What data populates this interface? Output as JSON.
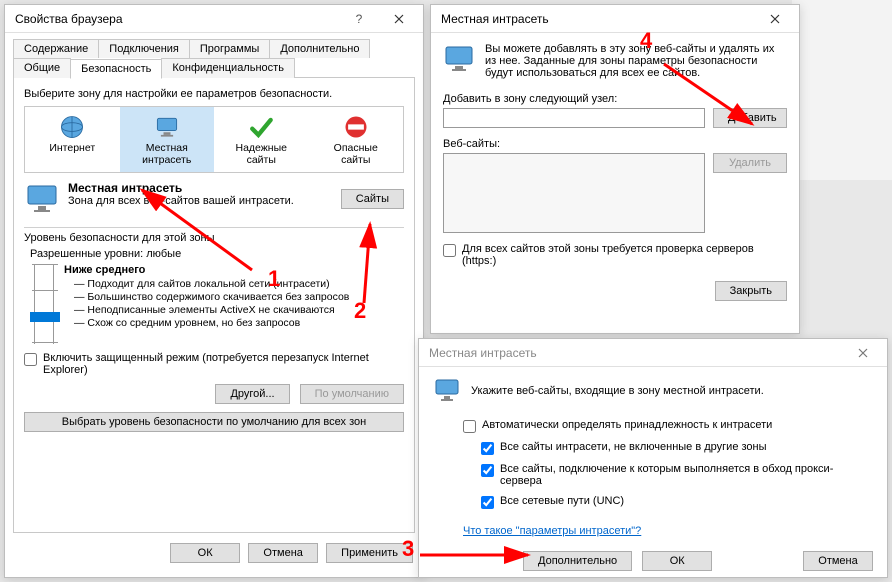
{
  "dlg1": {
    "title": "Свойства браузера",
    "tabs_row1": [
      "Содержание",
      "Подключения",
      "Программы",
      "Дополнительно"
    ],
    "tabs_row2": [
      "Общие",
      "Безопасность",
      "Конфиденциальность"
    ],
    "zone_prompt": "Выберите зону для настройки ее параметров безопасности.",
    "zones": [
      {
        "label": "Интернет"
      },
      {
        "label": "Местная\nинтрасеть"
      },
      {
        "label": "Надежные\nсайты"
      },
      {
        "label": "Опасные\nсайты"
      }
    ],
    "zone_header": "Местная интрасеть",
    "zone_desc": "Зона для всех веб-сайтов вашей интрасети.",
    "sites_btn": "Сайты",
    "level_group": "Уровень безопасности для этой зоны",
    "level_allowed": "Разрешенные уровни: любые",
    "level_name": "Ниже среднего",
    "level_points": [
      "— Подходит для сайтов локальной сети (интрасети)",
      "— Большинство содержимого скачивается без запросов",
      "— Неподписанные элементы ActiveX не скачиваются",
      "— Схож со средним уровнем, но без запросов"
    ],
    "protected_mode": "Включить защищенный режим (потребуется перезапуск Internet Explorer)",
    "custom_btn": "Другой...",
    "default_btn": "По умолчанию",
    "reset_all": "Выбрать уровень безопасности по умолчанию для всех зон",
    "ok": "ОК",
    "cancel": "Отмена",
    "apply": "Применить"
  },
  "dlg2": {
    "title": "Местная интрасеть",
    "intro": "Вы можете добавлять в эту зону веб-сайты и удалять их из нее. Заданные для зоны параметры безопасности будут использоваться для всех ее сайтов.",
    "add_label": "Добавить в зону следующий узел:",
    "add_btn": "Добавить",
    "sites_label": "Веб-сайты:",
    "remove_btn": "Удалить",
    "require_https": "Для всех сайтов этой зоны требуется проверка серверов (https:)",
    "close_btn": "Закрыть"
  },
  "dlg3": {
    "title": "Местная интрасеть",
    "intro": "Укажите веб-сайты, входящие в зону местной интрасети.",
    "cb1": "Автоматически определять принадлежность к интрасети",
    "cb2": "Все сайты интрасети, не включенные в другие зоны",
    "cb3": "Все сайты, подключение к которым выполняется в обход прокси-сервера",
    "cb4": "Все сетевые пути (UNC)",
    "link": "Что такое \"параметры интрасети\"?",
    "advanced": "Дополнительно",
    "ok": "ОК",
    "cancel": "Отмена"
  },
  "anno": {
    "n1": "1",
    "n2": "2",
    "n3": "3",
    "n4": "4"
  }
}
